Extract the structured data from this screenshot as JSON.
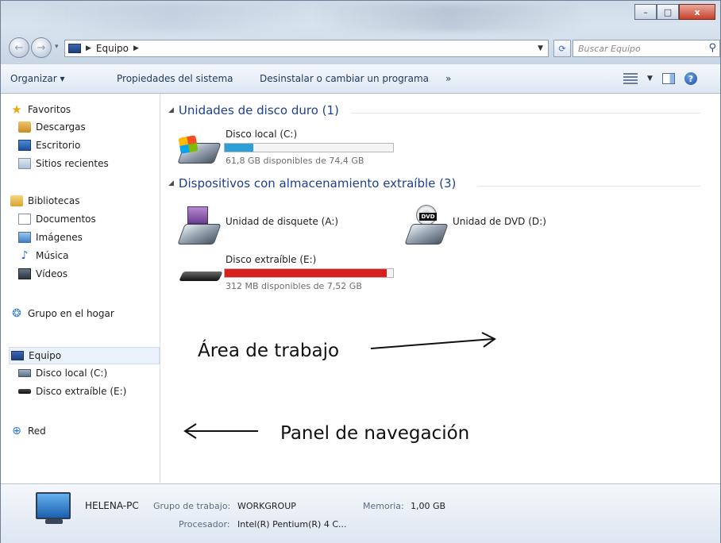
{
  "window": {
    "controls": {
      "minimize": "–",
      "maximize": "□",
      "close": "x"
    }
  },
  "nav": {
    "back": "←",
    "forward": "→",
    "address_path": "Equipo",
    "search_placeholder": "Buscar Equipo"
  },
  "toolbar": {
    "organize": "Organizar ▾",
    "system_props": "Propiedades del sistema",
    "uninstall": "Desinstalar o cambiar un programa",
    "more": "»",
    "help": "?"
  },
  "sidebar": {
    "favorites": "Favoritos",
    "downloads": "Descargas",
    "desktop": "Escritorio",
    "recent": "Sitios recientes",
    "libraries": "Bibliotecas",
    "documents": "Documentos",
    "images": "Imágenes",
    "music": "Música",
    "videos": "Vídeos",
    "homegroup": "Grupo en el hogar",
    "computer": "Equipo",
    "local_disk": "Disco local (C:)",
    "removable": "Disco extraíble (E:)",
    "network": "Red"
  },
  "content": {
    "hdd_group": "Unidades de disco duro (1)",
    "removable_group": "Dispositivos con almacenamiento extraíble (3)",
    "drives": {
      "c": {
        "name": "Disco local (C:)",
        "free": "61,8 GB disponibles de 74,4 GB",
        "used_fraction": 0.17,
        "bar_color": "#2b9fd6"
      },
      "a": {
        "name": "Unidad de disquete (A:)"
      },
      "d": {
        "name": "Unidad de DVD (D:)",
        "badge": "DVD"
      },
      "e": {
        "name": "Disco extraíble (E:)",
        "free": "312 MB disponibles de 7,52 GB",
        "used_fraction": 0.96,
        "bar_color": "#d9201c"
      }
    }
  },
  "annotations": {
    "work_area": "Área de trabajo",
    "nav_panel": "Panel de navegación"
  },
  "details": {
    "pc_name": "HELENA-PC",
    "workgroup_label": "Grupo de trabajo:",
    "workgroup_value": "WORKGROUP",
    "memory_label": "Memoria:",
    "memory_value": "1,00 GB",
    "processor_label": "Procesador:",
    "processor_value": "Intel(R) Pentium(R) 4 C..."
  }
}
